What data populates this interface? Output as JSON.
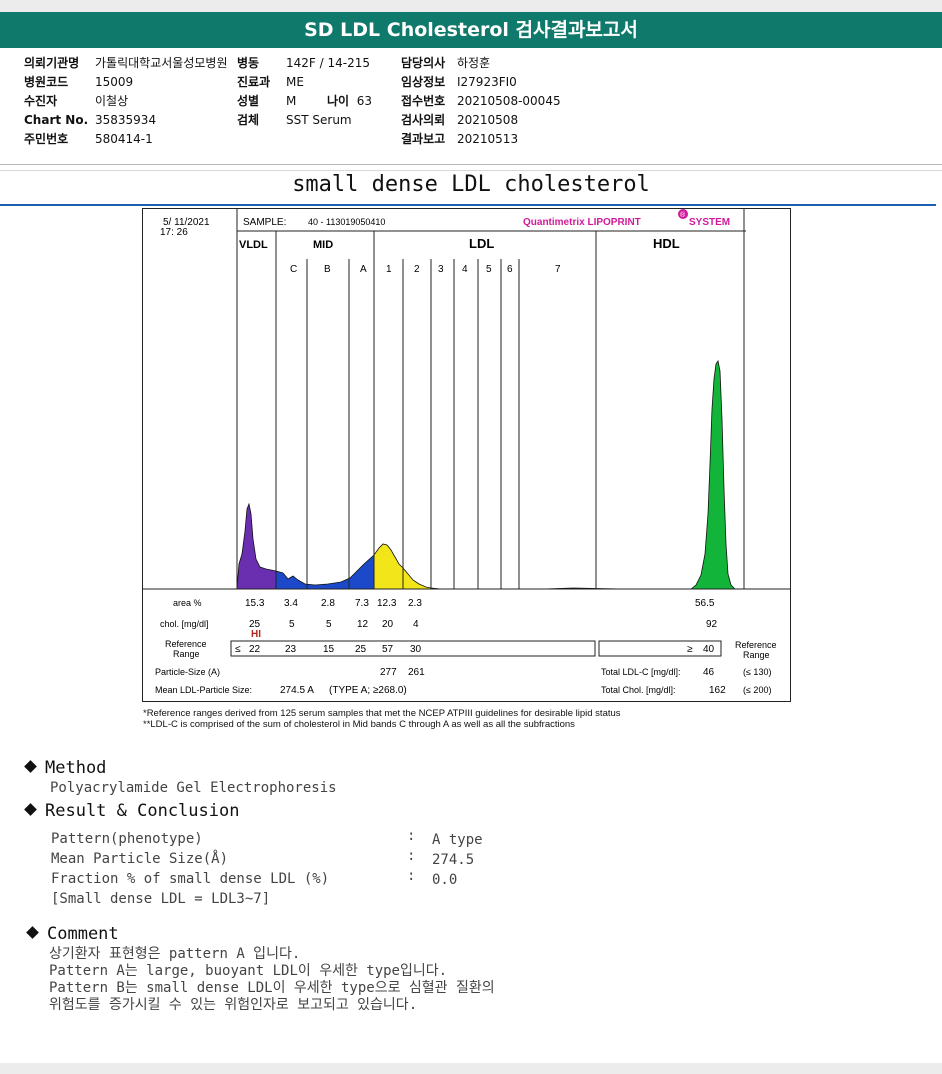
{
  "report_title": "SD LDL Cholesterol 검사결과보고서",
  "info": {
    "hospital_label": "의뢰기관명",
    "hospital_value": "가톨릭대학교서울성모병원",
    "ward_label": "병동",
    "ward_value": "142F / 14-215",
    "doctor_label": "담당의사",
    "doctor_value": "하정훈",
    "hospcode_label": "병원코드",
    "hospcode_value": "15009",
    "dept_label": "진료과",
    "dept_value": "ME",
    "clinical_label": "임상정보",
    "clinical_value": "I27923FI0",
    "patient_label": "수진자",
    "patient_value": "이철상",
    "sex_label": "성별",
    "sex_value": "M",
    "age_label": "나이",
    "age_value": "63",
    "accession_label": "접수번호",
    "accession_value": "20210508-00045",
    "chart_label": "Chart No.",
    "chart_value": "35835934",
    "specimen_label": "검체",
    "specimen_value": "SST Serum",
    "requested_label": "검사의뢰",
    "requested_value": "20210508",
    "id_label": "주민번호",
    "id_value": "580414-1",
    "reported_label": "결과보고",
    "reported_value": "20210513"
  },
  "subtitle": "small dense LDL cholesterol",
  "panel": {
    "date": "5/ 11/2021",
    "time": "17: 26",
    "sample_label": "SAMPLE:",
    "sample_value": "40 - 113019050410",
    "brand": "Quantimetrix LIPOPRINT",
    "brand_mark": "®",
    "brand_suffix": "SYSTEM",
    "zone_vldl": "VLDL",
    "zone_mid": "MID",
    "zone_ldl": "LDL",
    "zone_hdl": "HDL",
    "band_labels": [
      "C",
      "B",
      "A",
      "1",
      "2",
      "3",
      "4",
      "5",
      "6",
      "7"
    ],
    "colors": {
      "vldl": "#6a2fb0",
      "mid": "#1b49c9",
      "ldl1": "#f2e61a",
      "hdl": "#12b53a"
    }
  },
  "chart_data": {
    "type": "table",
    "fractions": [
      "VLDL",
      "C",
      "B",
      "A",
      "LDL1",
      "LDL2",
      "HDL"
    ],
    "area_label": "area %",
    "area_pct": [
      "15.3",
      "3.4",
      "2.8",
      "7.3",
      "12.3",
      "2.3",
      "56.5"
    ],
    "chol_label": "chol. [mg/dl]",
    "chol_mg_dl": [
      "25",
      "5",
      "5",
      "12",
      "20",
      "4",
      "92"
    ],
    "hi_flag": "HI",
    "ref_label": [
      "Reference",
      "Range"
    ],
    "ref_le": "≤",
    "ref_values": [
      "22",
      "23",
      "15",
      "25",
      "57",
      "30"
    ],
    "ref_hdl_ge": "≥",
    "ref_hdl_value": "40",
    "ref_right_label": [
      "Reference",
      "Range"
    ],
    "particle_size_label": "Particle-Size (A)",
    "particle_sizes": [
      "277",
      "261"
    ],
    "total_ldl_label": "Total LDL-C [mg/dl]:",
    "total_ldl_value": "46",
    "total_ldl_ref": "(≤ 130)",
    "mean_size_label": "Mean LDL-Particle Size:",
    "mean_size_value": "274.5 A",
    "mean_size_type": "(TYPE A; ≥268.0)",
    "total_chol_label": "Total Chol. [mg/dl]:",
    "total_chol_value": "162",
    "total_chol_ref": "(≤ 200)"
  },
  "footnote1": "*Reference ranges derived from 125 serum samples that met the NCEP ATPIII guidelines for desirable lipid status",
  "footnote2": "**LDL-C is comprised of the sum of cholesterol in Mid bands C through A as well as all the subfractions",
  "method": {
    "heading": "Method",
    "text": "Polyacrylamide Gel Electrophoresis"
  },
  "result": {
    "heading": "Result & Conclusion",
    "rows": [
      {
        "label": "Pattern(phenotype)",
        "sep": ":",
        "value": "A type"
      },
      {
        "label": "Mean Particle Size(Å)",
        "sep": ":",
        "value": "274.5"
      },
      {
        "label": "Fraction % of small dense LDL (%)",
        "sep": ":",
        "value": "0.0"
      }
    ],
    "note": "[Small dense LDL = LDL3~7]"
  },
  "comment": {
    "heading": "Comment",
    "lines": [
      "상기환자 표현형은 pattern A 입니다.",
      "Pattern A는 large, buoyant LDL이 우세한 type입니다.",
      "Pattern B는 small dense LDL이 우세한 type으로 심혈관 질환의",
      "위험도를 증가시킬 수 있는 위험인자로 보고되고 있습니다."
    ]
  }
}
